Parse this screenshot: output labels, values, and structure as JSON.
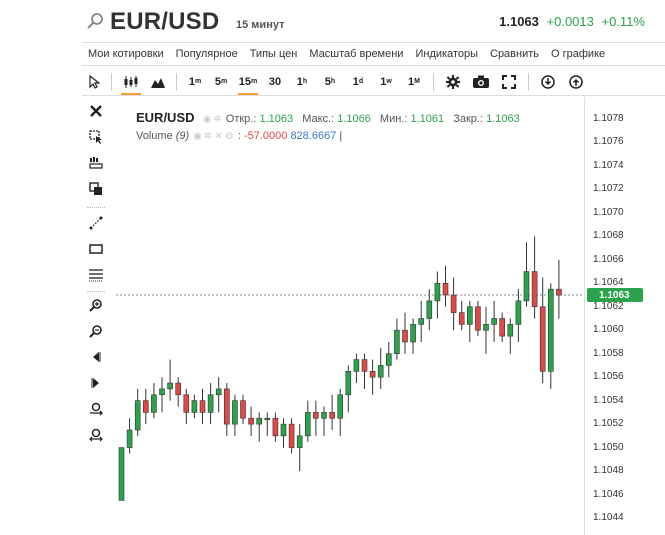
{
  "header": {
    "symbol": "EUR/USD",
    "interval": "15 минут",
    "price": "1.1063",
    "change": "+0.0013",
    "change_pct": "+0.11%"
  },
  "menu": [
    "Мои котировки",
    "Популярное",
    "Типы цен",
    "Масштаб времени",
    "Индикаторы",
    "Сравнить",
    "О графике"
  ],
  "toolbar": {
    "intervals": [
      {
        "num": "1",
        "unit": "m"
      },
      {
        "num": "5",
        "unit": "m"
      },
      {
        "num": "15",
        "unit": "m"
      },
      {
        "num": "30",
        "unit": ""
      },
      {
        "num": "1",
        "unit": "h"
      },
      {
        "num": "5",
        "unit": "h"
      },
      {
        "num": "1",
        "unit": "d"
      },
      {
        "num": "1",
        "unit": "w"
      },
      {
        "num": "1",
        "unit": "M"
      }
    ],
    "active_interval": "15"
  },
  "legend": {
    "symbol": "EUR/USD",
    "open_label": "Откр.:",
    "open": "1.1063",
    "high_label": "Макс.:",
    "high": "1.1066",
    "low_label": "Мин.:",
    "low": "1.1061",
    "close_label": "Закр.:",
    "close": "1.1063",
    "volume_label": "Volume",
    "volume_period": "(9)",
    "volume_val1": "-57.0000",
    "volume_val2": "828.6667",
    "volume_sep": "|"
  },
  "axis": {
    "ticks": [
      "1.1078",
      "1.1076",
      "1.1074",
      "1.1072",
      "1.1070",
      "1.1068",
      "1.1066",
      "1.1064",
      "1.1062",
      "1.1060",
      "1.1058",
      "1.1056",
      "1.1054",
      "1.1052",
      "1.1050",
      "1.1048",
      "1.1046",
      "1.1044"
    ],
    "current_price": "1.1063"
  },
  "colors": {
    "up": "#2aa34a",
    "down": "#e04848",
    "accent": "#f0a030"
  },
  "chart_data": {
    "type": "candlestick",
    "ylim": [
      1.1043,
      1.1079
    ],
    "current": 1.1063,
    "candles": [
      {
        "o": 1.10455,
        "h": 1.105,
        "l": 1.10455,
        "c": 1.105
      },
      {
        "o": 1.105,
        "h": 1.10525,
        "l": 1.10495,
        "c": 1.10515
      },
      {
        "o": 1.10515,
        "h": 1.1055,
        "l": 1.1051,
        "c": 1.1054
      },
      {
        "o": 1.1054,
        "h": 1.1055,
        "l": 1.1052,
        "c": 1.1053
      },
      {
        "o": 1.1053,
        "h": 1.10555,
        "l": 1.10525,
        "c": 1.10545
      },
      {
        "o": 1.10545,
        "h": 1.1056,
        "l": 1.1053,
        "c": 1.1055
      },
      {
        "o": 1.1055,
        "h": 1.10575,
        "l": 1.1054,
        "c": 1.10555
      },
      {
        "o": 1.10555,
        "h": 1.1056,
        "l": 1.10535,
        "c": 1.10545
      },
      {
        "o": 1.10545,
        "h": 1.1055,
        "l": 1.1052,
        "c": 1.1053
      },
      {
        "o": 1.1053,
        "h": 1.10545,
        "l": 1.10525,
        "c": 1.1054
      },
      {
        "o": 1.1054,
        "h": 1.1055,
        "l": 1.1052,
        "c": 1.1053
      },
      {
        "o": 1.1053,
        "h": 1.10555,
        "l": 1.1052,
        "c": 1.10545
      },
      {
        "o": 1.10545,
        "h": 1.1056,
        "l": 1.1053,
        "c": 1.1055
      },
      {
        "o": 1.1055,
        "h": 1.10555,
        "l": 1.1051,
        "c": 1.1052
      },
      {
        "o": 1.1052,
        "h": 1.10545,
        "l": 1.1051,
        "c": 1.1054
      },
      {
        "o": 1.1054,
        "h": 1.10545,
        "l": 1.1052,
        "c": 1.10525
      },
      {
        "o": 1.10525,
        "h": 1.10535,
        "l": 1.1051,
        "c": 1.1052
      },
      {
        "o": 1.1052,
        "h": 1.1053,
        "l": 1.10505,
        "c": 1.10525
      },
      {
        "o": 1.10525,
        "h": 1.1053,
        "l": 1.1051,
        "c": 1.10525
      },
      {
        "o": 1.10525,
        "h": 1.1053,
        "l": 1.10505,
        "c": 1.1051
      },
      {
        "o": 1.1051,
        "h": 1.10525,
        "l": 1.105,
        "c": 1.1052
      },
      {
        "o": 1.1052,
        "h": 1.10525,
        "l": 1.10495,
        "c": 1.105
      },
      {
        "o": 1.105,
        "h": 1.1052,
        "l": 1.1048,
        "c": 1.1051
      },
      {
        "o": 1.1051,
        "h": 1.1054,
        "l": 1.10505,
        "c": 1.1053
      },
      {
        "o": 1.1053,
        "h": 1.1054,
        "l": 1.1051,
        "c": 1.10525
      },
      {
        "o": 1.10525,
        "h": 1.10535,
        "l": 1.1051,
        "c": 1.1053
      },
      {
        "o": 1.1053,
        "h": 1.10545,
        "l": 1.10515,
        "c": 1.10525
      },
      {
        "o": 1.10525,
        "h": 1.1055,
        "l": 1.1051,
        "c": 1.10545
      },
      {
        "o": 1.10545,
        "h": 1.1057,
        "l": 1.1053,
        "c": 1.10565
      },
      {
        "o": 1.10565,
        "h": 1.1058,
        "l": 1.10555,
        "c": 1.10575
      },
      {
        "o": 1.10575,
        "h": 1.1058,
        "l": 1.1055,
        "c": 1.10565
      },
      {
        "o": 1.10565,
        "h": 1.10575,
        "l": 1.10545,
        "c": 1.1056
      },
      {
        "o": 1.1056,
        "h": 1.10585,
        "l": 1.1055,
        "c": 1.1057
      },
      {
        "o": 1.1057,
        "h": 1.1059,
        "l": 1.1056,
        "c": 1.1058
      },
      {
        "o": 1.1058,
        "h": 1.1061,
        "l": 1.10575,
        "c": 1.106
      },
      {
        "o": 1.106,
        "h": 1.10615,
        "l": 1.1058,
        "c": 1.1059
      },
      {
        "o": 1.1059,
        "h": 1.1061,
        "l": 1.1058,
        "c": 1.10605
      },
      {
        "o": 1.10605,
        "h": 1.10625,
        "l": 1.1059,
        "c": 1.1061
      },
      {
        "o": 1.1061,
        "h": 1.10635,
        "l": 1.106,
        "c": 1.10625
      },
      {
        "o": 1.10625,
        "h": 1.1065,
        "l": 1.1061,
        "c": 1.1064
      },
      {
        "o": 1.1064,
        "h": 1.10655,
        "l": 1.1062,
        "c": 1.1063
      },
      {
        "o": 1.1063,
        "h": 1.10645,
        "l": 1.106,
        "c": 1.10615
      },
      {
        "o": 1.10615,
        "h": 1.10625,
        "l": 1.106,
        "c": 1.10605
      },
      {
        "o": 1.10605,
        "h": 1.10625,
        "l": 1.1059,
        "c": 1.1062
      },
      {
        "o": 1.1062,
        "h": 1.10625,
        "l": 1.10595,
        "c": 1.106
      },
      {
        "o": 1.106,
        "h": 1.1062,
        "l": 1.1058,
        "c": 1.10605
      },
      {
        "o": 1.10605,
        "h": 1.10625,
        "l": 1.1059,
        "c": 1.1061
      },
      {
        "o": 1.1061,
        "h": 1.10615,
        "l": 1.1059,
        "c": 1.10595
      },
      {
        "o": 1.10595,
        "h": 1.1061,
        "l": 1.1058,
        "c": 1.10605
      },
      {
        "o": 1.10605,
        "h": 1.10635,
        "l": 1.1059,
        "c": 1.10625
      },
      {
        "o": 1.10625,
        "h": 1.10675,
        "l": 1.1062,
        "c": 1.1065
      },
      {
        "o": 1.1065,
        "h": 1.1068,
        "l": 1.1061,
        "c": 1.1062
      },
      {
        "o": 1.1062,
        "h": 1.10645,
        "l": 1.10555,
        "c": 1.10565
      },
      {
        "o": 1.10565,
        "h": 1.1064,
        "l": 1.1055,
        "c": 1.10635
      },
      {
        "o": 1.10635,
        "h": 1.1066,
        "l": 1.1061,
        "c": 1.1063
      }
    ]
  }
}
